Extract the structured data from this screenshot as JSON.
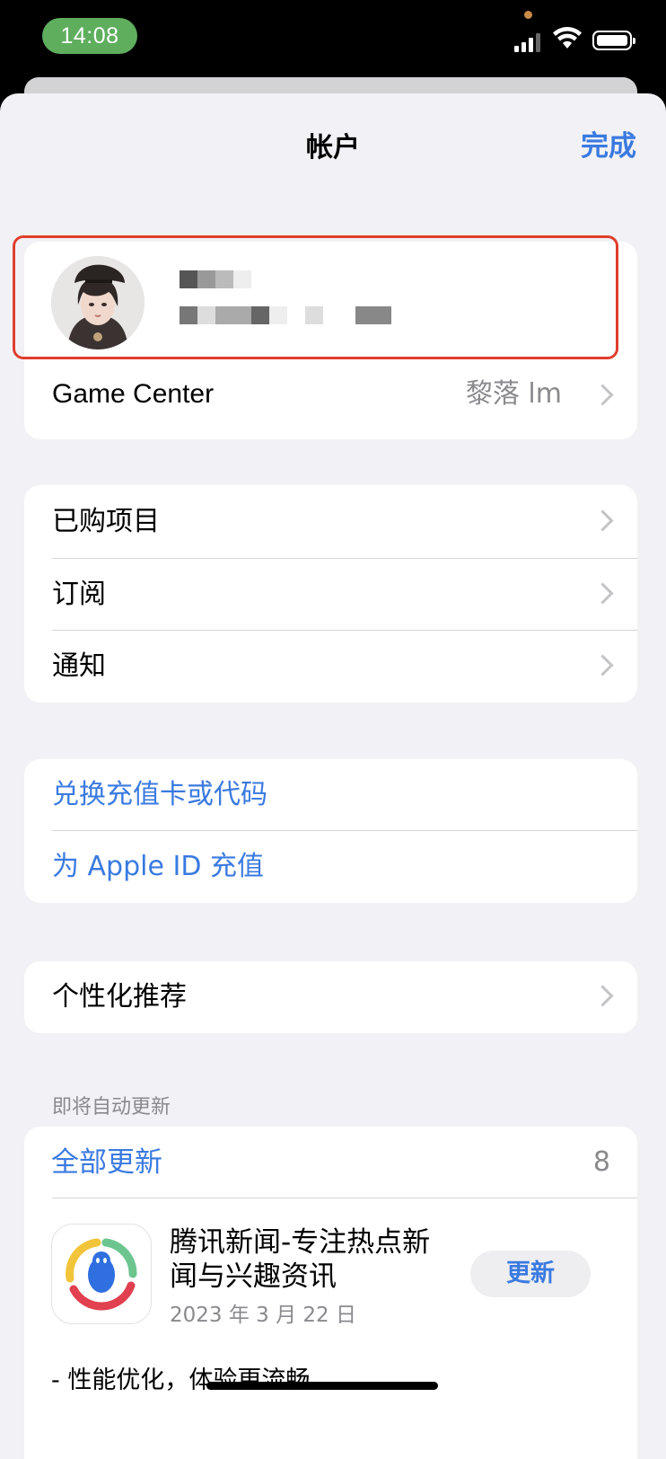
{
  "status_bar": {
    "time": "14:08",
    "icons": [
      "signal-icon",
      "wifi-icon",
      "battery-icon"
    ]
  },
  "nav": {
    "title": "帐户",
    "done_label": "完成"
  },
  "profile": {
    "name_redacted": true,
    "email_redacted": true
  },
  "game_center": {
    "label": "Game Center",
    "value": "黎落 lm"
  },
  "menu_group": {
    "items": [
      {
        "label": "已购项目"
      },
      {
        "label": "订阅"
      },
      {
        "label": "通知"
      }
    ]
  },
  "links_group": {
    "items": [
      {
        "label": "兑换充值卡或代码"
      },
      {
        "label": "为 Apple ID 充值"
      }
    ]
  },
  "personalized": {
    "label": "个性化推荐"
  },
  "auto_update": {
    "section_label": "即将自动更新",
    "update_all_label": "全部更新",
    "count": "8",
    "app": {
      "name": "腾讯新闻-专注热点新闻与兴趣资讯",
      "date": "2023 年 3 月 22 日",
      "button_label": "更新",
      "note": "- 性能优化，体验更流畅"
    }
  },
  "colors": {
    "accent": "#3a7ae0",
    "highlight_border": "#e03e2d",
    "time_pill": "#5fae5e",
    "background": "#f2f2f6"
  }
}
